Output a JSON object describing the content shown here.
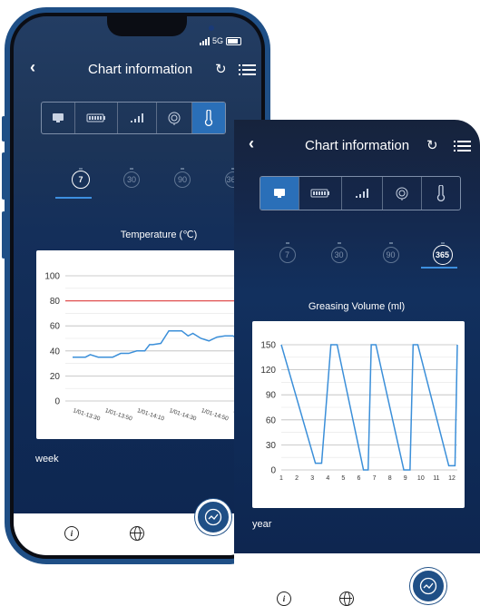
{
  "back_phone": {
    "status": {
      "network": "5G"
    },
    "header": {
      "title": "Chart information"
    },
    "category_icons": [
      "monitor-icon",
      "battery-icon",
      "signal-icon",
      "gauge-icon",
      "thermometer-icon"
    ],
    "active_category": 4,
    "periods": [
      "7",
      "30",
      "90",
      "365"
    ],
    "active_period": 0,
    "period_label": "week",
    "chart_data": {
      "type": "line",
      "title": "Temperature (℃)",
      "ylim": [
        0,
        100
      ],
      "yticks": [
        0,
        20,
        40,
        60,
        80,
        100
      ],
      "threshold": 80,
      "xticks": [
        "1/01-13:30",
        "1/01-13:50",
        "1/01-14:10",
        "1/01-14:30",
        "1/01-14:50",
        "1/01-15:10"
      ],
      "series": [
        {
          "x": [
            0,
            0.4,
            0.55,
            0.8,
            1.0,
            1.25,
            1.5,
            1.75,
            2.0,
            2.25,
            2.4,
            2.5,
            2.75,
            3.0,
            3.25,
            3.4,
            3.6,
            3.75,
            4.0,
            4.25,
            4.5,
            4.75,
            5.0,
            5.25
          ],
          "values": [
            35,
            35,
            37,
            35,
            35,
            35,
            38,
            38,
            40,
            40,
            45,
            45,
            46,
            56,
            56,
            56,
            52,
            54,
            50,
            48,
            51,
            52,
            52,
            48
          ]
        }
      ],
      "colors": {
        "line": "#3b8fd9",
        "threshold": "#e05050"
      }
    },
    "tabbar": {
      "info": "i"
    }
  },
  "front_phone": {
    "header": {
      "title": "Chart information"
    },
    "category_icons": [
      "monitor-icon",
      "battery-icon",
      "signal-icon",
      "gauge-icon",
      "thermometer-icon"
    ],
    "active_category": 0,
    "periods": [
      "7",
      "30",
      "90",
      "365"
    ],
    "active_period": 3,
    "period_label": "year",
    "chart_data": {
      "type": "line",
      "title": "Greasing Volume (ml)",
      "ylim": [
        0,
        150
      ],
      "yticks": [
        0,
        30,
        60,
        90,
        120,
        150
      ],
      "xticks": [
        "1",
        "2",
        "3",
        "4",
        "5",
        "6",
        "7",
        "8",
        "9",
        "10",
        "11",
        "12"
      ],
      "series": [
        {
          "x": [
            1,
            3.2,
            3.6,
            4.2,
            4.6,
            6.3,
            6.6,
            6.8,
            7.1,
            8.9,
            9.3,
            9.5,
            9.8,
            11.8,
            12.2,
            12.35
          ],
          "values": [
            150,
            8,
            8,
            150,
            150,
            0,
            0,
            150,
            150,
            0,
            0,
            150,
            150,
            5,
            5,
            150
          ]
        }
      ],
      "colors": {
        "line": "#3b8fd9"
      }
    },
    "tabbar": {
      "info": "i"
    }
  },
  "colors": {
    "accent": "#2a6fb8",
    "frame": "#1f4f86",
    "screen_bg": "#12305e"
  }
}
